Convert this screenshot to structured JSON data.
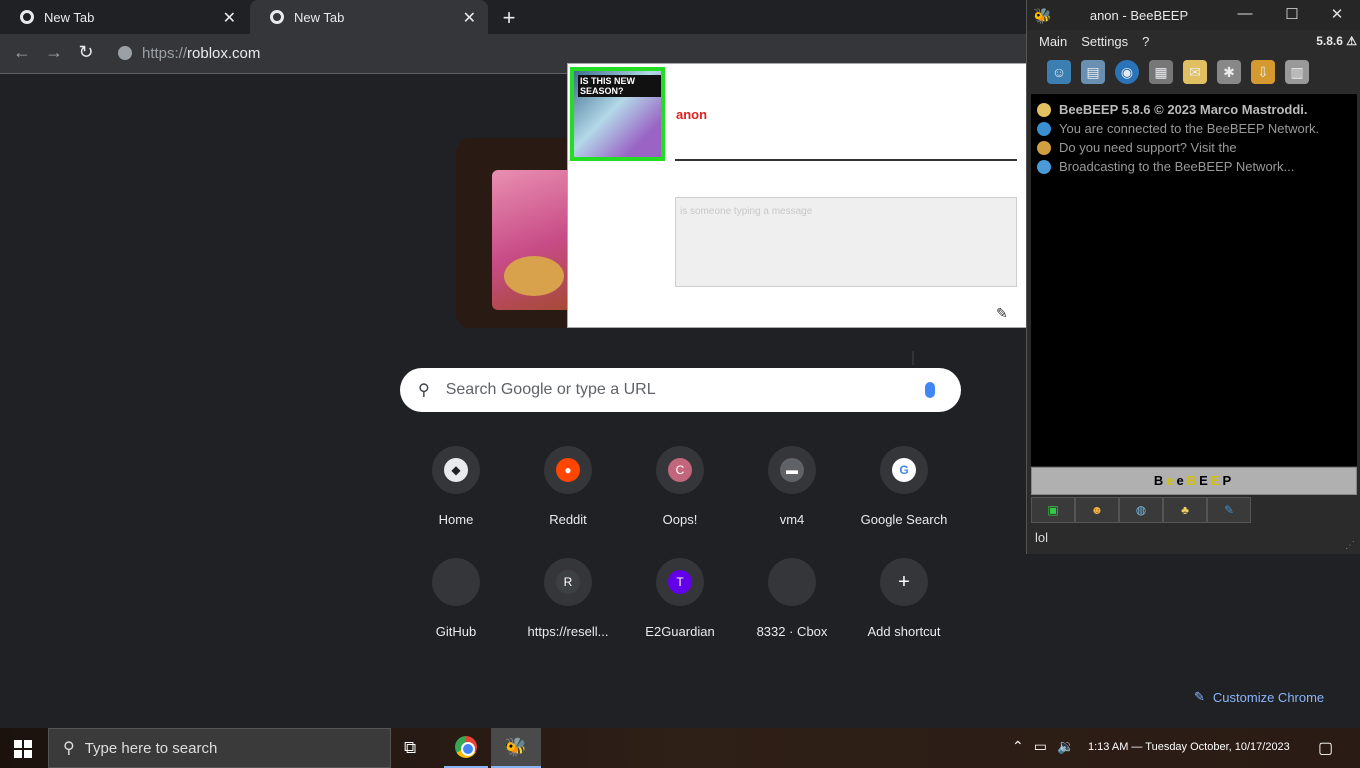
{
  "browser": {
    "tabs": [
      {
        "title": "New Tab"
      },
      {
        "title": "New Tab"
      }
    ],
    "url_scheme": "https://",
    "url_host": "roblox.com",
    "icons": {
      "back": "back-arrow-icon",
      "forward": "forward-arrow-icon",
      "reload": "reload-icon",
      "site_info": "site-info-icon"
    }
  },
  "ntp": {
    "search_placeholder": "Search Google or type a URL",
    "shortcuts_row1": [
      {
        "label": "Home",
        "glyph": "◆",
        "badge_color": "#e8eaed"
      },
      {
        "label": "Reddit",
        "glyph": "●",
        "badge_color": "#ff4500"
      },
      {
        "label": "Oops!",
        "glyph": "C",
        "badge_color": "#c2677b"
      },
      {
        "label": "vm4",
        "glyph": "▬",
        "badge_color": "#5f6368"
      },
      {
        "label": "Google Search",
        "glyph": "G",
        "badge_color": "#ffffff"
      }
    ],
    "shortcuts_row2": [
      {
        "label": "GitHub",
        "glyph": "",
        "badge_color": "#35363a"
      },
      {
        "label": "https://resell...",
        "glyph": "R",
        "badge_color": "#3c4043"
      },
      {
        "label": "E2Guardian",
        "glyph": "T",
        "badge_color": "#6200ea"
      },
      {
        "label": "8332 · Cbox",
        "glyph": "",
        "badge_color": "#35363a"
      },
      {
        "label": "Add shortcut",
        "glyph": "+",
        "badge_color": "#35363a"
      }
    ],
    "customize_label": "Customize Chrome"
  },
  "popup": {
    "avatar_text": "IS THIS NEW SEASON?",
    "name": "anon",
    "hint_text": "is someone typing a message"
  },
  "beebeep": {
    "title": "anon - BeeBEEP",
    "menu": [
      "Main",
      "Settings",
      "?"
    ],
    "version": "5.8.6",
    "log": [
      {
        "text": "BeeBEEP 5.8.6 © 2023 Marco Mastroddi.",
        "bold": true,
        "icon_color": "#e0c060"
      },
      {
        "text": "You are connected to the BeeBEEP Network.",
        "bold": false,
        "icon_color": "#3a8fd0"
      },
      {
        "text": "Do you need support? Visit the",
        "bold": false,
        "icon_color": "#d0a040"
      },
      {
        "text": "Broadcasting to the BeeBEEP Network...",
        "bold": false,
        "icon_color": "#4a9ad8"
      }
    ],
    "banner": "BeeBEEP",
    "input_text": "lol",
    "colors": {
      "banner_bg": "#b0b0b0",
      "log_bg": "#000000"
    }
  },
  "taskbar": {
    "search_placeholder": "Type here to search",
    "clock": "1:13 AM — Tuesday October, 10/17/2023"
  }
}
